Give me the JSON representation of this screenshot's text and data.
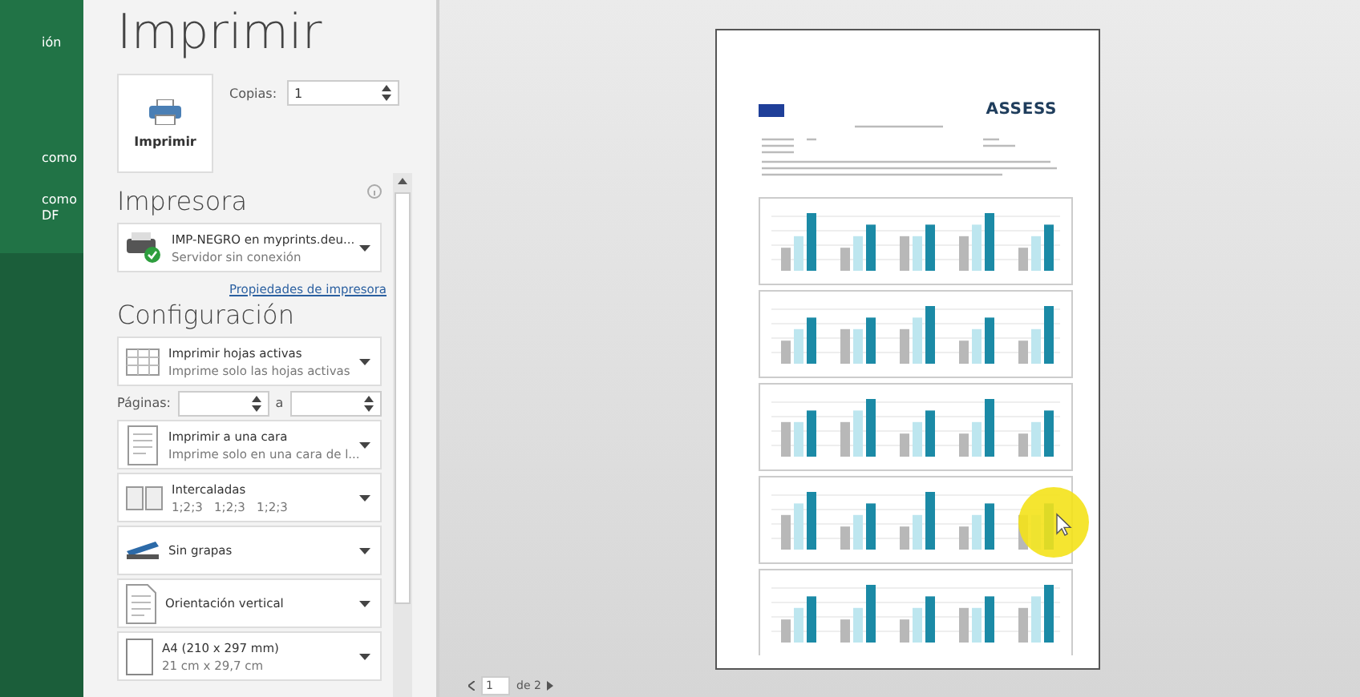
{
  "sidebar": {
    "items": [
      {
        "lines": [
          "ión"
        ]
      },
      {
        "lines": [
          "como"
        ]
      },
      {
        "lines": [
          "como",
          "DF"
        ]
      }
    ]
  },
  "title": "Imprimir",
  "print_button": {
    "label": "Imprimir"
  },
  "copies": {
    "label": "Copias:",
    "value": "1"
  },
  "printer_section": {
    "heading": "Impresora",
    "printer": {
      "name": "IMP-NEGRO en myprints.deu...",
      "status": "Servidor sin conexión"
    },
    "properties_link": "Propiedades de impresora"
  },
  "settings_section": {
    "heading": "Configuración",
    "items": [
      {
        "kind": "sheets",
        "title": "Imprimir hojas activas",
        "subtitle": "Imprime solo las hojas activas"
      },
      {
        "kind": "pages",
        "label": "Páginas:",
        "separator": "a"
      },
      {
        "kind": "sides",
        "title": "Imprimir a una cara",
        "subtitle": "Imprime solo en una cara de l..."
      },
      {
        "kind": "collate",
        "title": "Intercaladas",
        "subtitle": "1;2;3   1;2;3   1;2;3"
      },
      {
        "kind": "staple",
        "title": "Sin grapas"
      },
      {
        "kind": "orientation",
        "title": "Orientación vertical"
      },
      {
        "kind": "paper",
        "title": "A4 (210 x 297 mm)",
        "subtitle": "21 cm x 29,7 cm"
      }
    ]
  },
  "preview": {
    "logo_text": "ASSESS",
    "pager": {
      "current": "1",
      "total": "de 2"
    }
  }
}
